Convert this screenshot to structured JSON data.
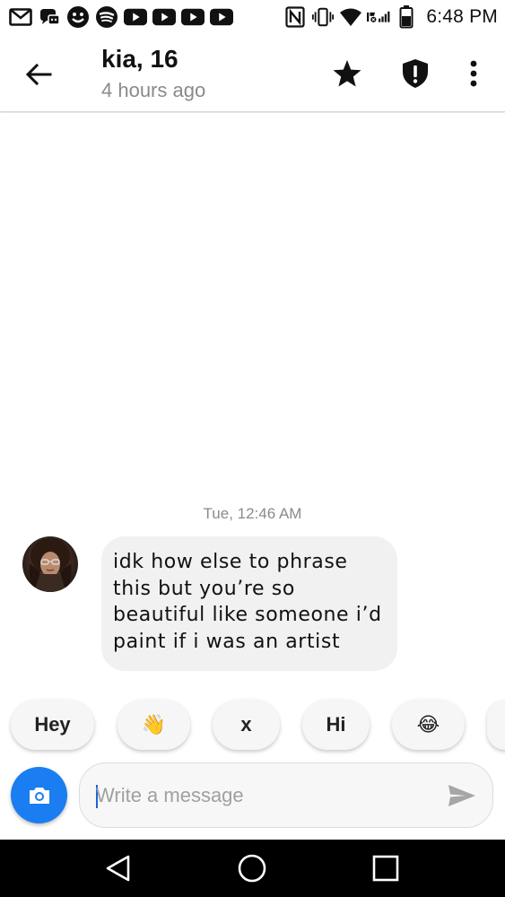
{
  "status_bar": {
    "time": "6:48 PM",
    "left_icons": [
      "gmail-icon",
      "messenger-games-icon",
      "smiley-icon",
      "spotify-icon",
      "youtube-icon",
      "youtube-icon",
      "youtube-icon",
      "youtube-icon"
    ],
    "right_icons": [
      "nfc-icon",
      "vibrate-icon",
      "wifi-icon",
      "signal-icon",
      "battery-icon"
    ]
  },
  "header": {
    "name": "kia, 16",
    "last_seen": "4 hours ago",
    "actions": [
      "star-icon",
      "shield-alert-icon",
      "more-vert-icon"
    ]
  },
  "conversation": {
    "timestamp": "Tue, 12:46 AM",
    "messages": [
      {
        "from": "kia",
        "text": "idk how else to phrase this but you’re so beautiful like someone i’d paint if i was an artist"
      }
    ]
  },
  "quick_replies": [
    "Hey",
    "👋",
    "x",
    "Hi",
    "😂"
  ],
  "composer": {
    "placeholder": "Write a message"
  },
  "colors": {
    "accent": "#1a7df2",
    "bubble": "#f1f1f1",
    "muted_text": "#8a8a8a"
  }
}
